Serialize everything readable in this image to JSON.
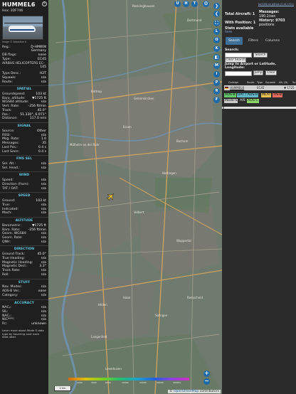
{
  "left": {
    "callsign": "HUMMEL6",
    "hex_line": "Hex:  3DF746",
    "photo_credit": "Image © Sebastian K",
    "reg_rows": [
      {
        "k": "Reg.:",
        "v": "D-HMWW"
      },
      {
        "k": "",
        "v": "Germany"
      },
      {
        "k": "DB flags:",
        "v": "none"
      },
      {
        "k": "Type:",
        "v": "EC45"
      },
      {
        "k": "AIRBUS HELICOPTERS EC-",
        "v": ""
      },
      {
        "k": "",
        "v": "145"
      }
    ],
    "misc_rows": [
      {
        "k": "Type Desc.:",
        "v": "H2T"
      },
      {
        "k": "Squawk:",
        "v": "n/a"
      },
      {
        "k": "Route:",
        "v": "n/a"
      }
    ],
    "sections": [
      {
        "title": "SPATIAL",
        "rows": [
          {
            "k": "Groundspeed:",
            "v": "103 kt"
          },
          {
            "k": "Baro. altitude:",
            "v": "▼1725 ft"
          },
          {
            "k": "WGS84 altitude:",
            "v": "n/a"
          },
          {
            "k": "Vert. Rate:",
            "v": "-256 ft/min"
          },
          {
            "k": "Track:",
            "v": "45.0°"
          },
          {
            "k": "Pos.:",
            "v": "51.330°, 6.971°"
          },
          {
            "k": "Distance:",
            "v": "117.0 nmi"
          }
        ]
      },
      {
        "title": "SIGNAL",
        "rows": [
          {
            "k": "Source:",
            "v": "Other"
          },
          {
            "k": "RSSI:",
            "v": "n/a"
          },
          {
            "k": "Msg. Rate:",
            "v": "1.0"
          },
          {
            "k": "Messages:",
            "v": "35"
          },
          {
            "k": "",
            "v": ""
          },
          {
            "k": "Last Pos.:",
            "v": "0.4 s"
          },
          {
            "k": "Last Seen:",
            "v": "0.4 s"
          }
        ]
      },
      {
        "title": "FMS SEL",
        "rows": [
          {
            "k": "Sel. Alt.:",
            "v": "n/a"
          },
          {
            "k": "Sel. Head.:",
            "v": "n/a"
          }
        ]
      },
      {
        "title": "WIND",
        "rows": [
          {
            "k": "Speed:",
            "v": "n/a"
          },
          {
            "k": "Direction (from):",
            "v": "n/a"
          },
          {
            "k": "TAT / OAT:",
            "v": "n/a"
          }
        ]
      },
      {
        "title": "SPEED",
        "rows": [
          {
            "k": "Ground:",
            "v": "103 kt"
          },
          {
            "k": "True:",
            "v": "n/a"
          },
          {
            "k": "Indicated:",
            "v": "n/a"
          },
          {
            "k": "Mach:",
            "v": "n/a"
          }
        ]
      },
      {
        "title": "ALTITUDE",
        "rows": [
          {
            "k": "Barometric:",
            "v": "▼1725 ft"
          },
          {
            "k": "Baro. Rate:",
            "v": "-256 ft/min"
          },
          {
            "k": "Geom. WGS84:",
            "v": "n/a"
          },
          {
            "k": "Geom. Rate:",
            "v": "n/a"
          },
          {
            "k": "QNH:",
            "v": "n/a"
          }
        ]
      },
      {
        "title": "DIRECTION",
        "rows": [
          {
            "k": "Ground Track:",
            "v": "45.0°"
          },
          {
            "k": "True Heading:",
            "v": "n/a"
          },
          {
            "k": "Magnetic Heading:",
            "v": "n/a"
          },
          {
            "k": "Magnetic Decl.:",
            "v": "3.3°"
          },
          {
            "k": "Track Rate:",
            "v": "n/a"
          },
          {
            "k": "Roll:",
            "v": "n/a"
          }
        ]
      },
      {
        "title": "STUFF",
        "rows": [
          {
            "k": "Nav. Modes:",
            "v": "n/a"
          },
          {
            "k": "ADS-B Ver.:",
            "v": "none"
          },
          {
            "k": "Category:",
            "v": "n/a"
          }
        ]
      },
      {
        "title": "ACCURACY",
        "rows": [
          {
            "k": "NACₚ:",
            "v": "n/a"
          },
          {
            "k": "SIL:",
            "v": "n/a"
          },
          {
            "k": "NACᵥ:",
            "v": "n/a"
          },
          {
            "k": "NICᴮᴬᴿᴼ:",
            "v": "n/a"
          },
          {
            "k": "Rc:",
            "v": "unknown"
          }
        ]
      }
    ],
    "footer": "Learn more about Mode S data type by hovering over each data label."
  },
  "map": {
    "top_buttons": [
      "U",
      "H",
      "T"
    ],
    "side_buttons": [
      "L",
      "O",
      "K",
      "M",
      "I",
      "P",
      "R",
      "F"
    ],
    "zoom_in": "+",
    "zoom_out": "−",
    "scale_label": "2 km",
    "attribution_prefix": "© ",
    "attribution_link": "OpenStreetMap",
    "attribution_suffix": " contributors",
    "altitude_ticks": [
      "2000",
      "4000",
      "6000",
      "10000",
      "20000",
      "30000",
      "40000+"
    ],
    "places": [
      "Dortmund",
      "Recklinghausen",
      "Bottrop",
      "Gelsenkirchen",
      "Essen",
      "Mülheim an der Ruhr",
      "Bochum",
      "Hattingen",
      "Velbert",
      "Wuppertal",
      "Remscheid",
      "Solingen",
      "Haan",
      "Hilden",
      "Langenfeld",
      "Leverkusen"
    ]
  },
  "right": {
    "top_link": "tar1090 on github (3.14.1751)",
    "total_label": "Total Aircraft: 1",
    "messages_label": "Messages:",
    "messages_value": "190.2/sec",
    "position_label": "With Position: 1",
    "history_label": "History: 9703",
    "history_value": "positions",
    "stats_link": "Stats available here",
    "tabs": [
      "Search",
      "Filters",
      "Columns"
    ],
    "search_label": "Search:",
    "search_button": "Search",
    "clear_search": "Clear Search",
    "jump_label": "Jump to Airport or Latitude, Longitude:",
    "jump_button": "Jump",
    "clear_button": "Clear",
    "columns": [
      "Callsign",
      "Route",
      "Type",
      "Squawk",
      "Alt. (ft)",
      "Sp"
    ],
    "row": {
      "callsign": "HUMMEL6",
      "route": "",
      "type": "EC45",
      "squawk": "",
      "alt": "▼ 1725",
      "speed": ""
    },
    "badges": [
      {
        "label": "ADS-B",
        "color": "#63c96a"
      },
      {
        "label": "UAT / ADS-R",
        "color": "#63b8c8"
      },
      {
        "label": "MLAT",
        "color": "#e7bf52"
      },
      {
        "label": "TIS-B",
        "color": "#e46d5f"
      },
      {
        "label": "Mode-S",
        "color": "#c9c9c9"
      },
      {
        "label": "AIS",
        "color": "#2b2b2b"
      },
      {
        "label": "ADS-C",
        "color": "#8fd46a"
      }
    ]
  }
}
